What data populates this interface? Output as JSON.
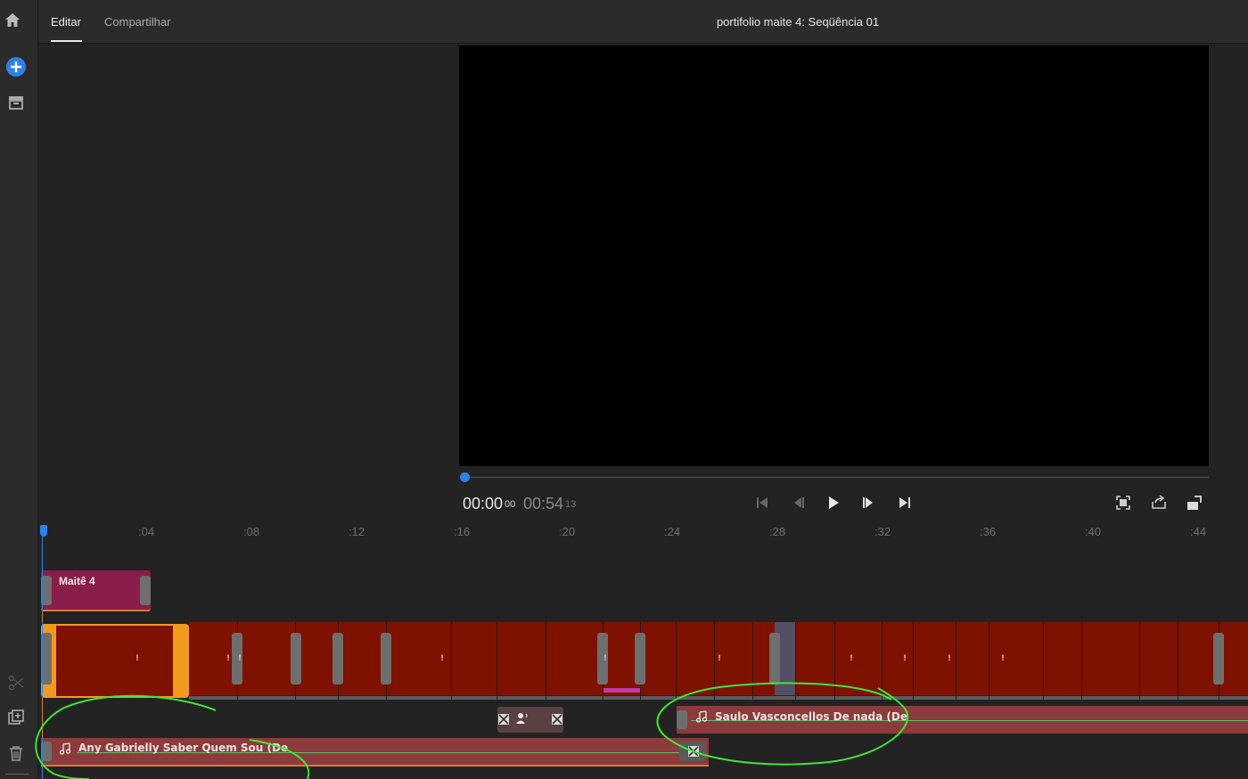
{
  "topbar": {
    "tabs": [
      {
        "label": "Editar",
        "active": true
      },
      {
        "label": "Compartilhar",
        "active": false
      }
    ],
    "title": "portifolio maite 4: Seqüência 01"
  },
  "rail": {
    "icons": [
      "home-icon",
      "add-media-icon",
      "library-icon",
      "scissors-icon",
      "add-track-icon",
      "trash-icon"
    ],
    "accent": "#2d82e6"
  },
  "player": {
    "current_time": "00:00",
    "current_frames": "00",
    "duration": "00:54",
    "duration_frames": "13",
    "playhead_fraction": 0,
    "controls": [
      "go-to-start-icon",
      "step-back-icon",
      "play-icon",
      "step-forward-icon",
      "go-to-end-icon"
    ],
    "right_controls": [
      "fit-screen-icon",
      "share-icon",
      "resize-icon"
    ]
  },
  "ruler": {
    "ticks": [
      "0",
      ":04",
      ":08",
      ":12",
      ":16",
      ":20",
      ":24",
      ":28",
      ":32",
      ":36",
      ":40",
      ":44"
    ]
  },
  "timeline": {
    "title_clip": {
      "label": "Maitê   4",
      "color": "#8a1d4a"
    },
    "video_color": "#7e1100",
    "selection_color": "#f29a1e",
    "audio": [
      {
        "label": "Saulo Vasconcellos   De nada (De",
        "color": "#8b3b3b"
      },
      {
        "label": "Any Gabrielly   Saber Quem Sou (De",
        "color": "#8b3b3b"
      }
    ]
  }
}
